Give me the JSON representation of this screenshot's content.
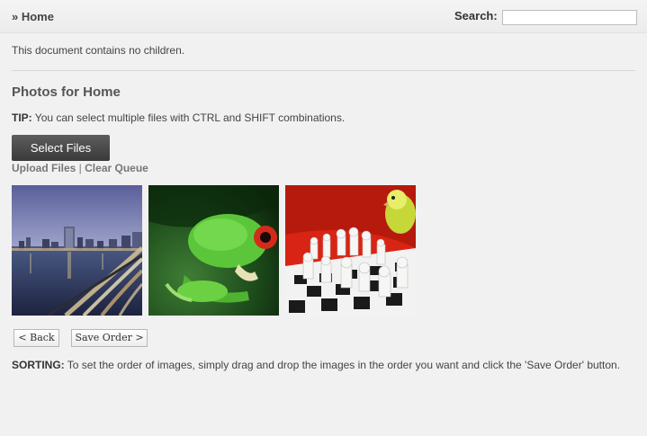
{
  "header": {
    "breadcrumb": "» Home",
    "search_label": "Search:",
    "search_value": ""
  },
  "notice": "This document contains no children.",
  "photos": {
    "title": "Photos for Home",
    "tip_label": "TIP:",
    "tip_text": " You can select multiple files with CTRL and SHIFT combinations.",
    "select_files_label": "Select Files",
    "upload_label": "Upload Files",
    "separator": " | ",
    "clear_label": "Clear Queue",
    "images": [
      {
        "subject": "city-skyline-night"
      },
      {
        "subject": "green-tree-frog"
      },
      {
        "subject": "parakeet-and-chess-pieces"
      }
    ]
  },
  "actions": {
    "back_label": "< Back",
    "save_label": "Save Order >"
  },
  "sorting": {
    "label": "SORTING:",
    "text": " To set the order of images, simply drag and drop the images in the order you want and click the 'Save Order' button."
  },
  "colors": {
    "button_dark": "#454545",
    "page_bg": "#f1f1f1",
    "link_gray": "#777777"
  },
  "icons": [
    "breadcrumb-arrow-icon"
  ]
}
